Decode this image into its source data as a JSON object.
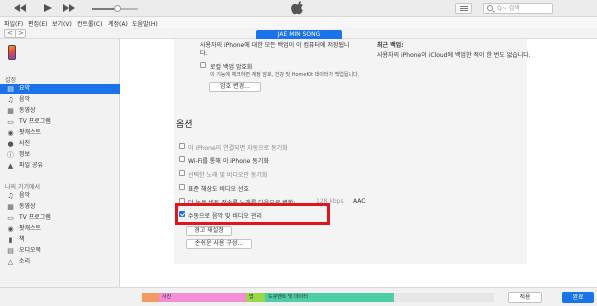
{
  "toolbar": {
    "search_placeholder": "Q~ 검색",
    "volume_level": 0.55
  },
  "menubar": {
    "items": [
      "파일(F)",
      "편집(E)",
      "보기(V)",
      "컨트롤(C)",
      "계정(A)",
      "도움말(H)"
    ]
  },
  "navbar": {
    "back": "<",
    "forward": ">",
    "device_name": "JAE MIN SONG"
  },
  "sidebar": {
    "settings_header": "설정",
    "settings_items": [
      {
        "label": "요약",
        "icon": "summary-icon",
        "selected": true
      },
      {
        "label": "음악",
        "icon": "music-icon"
      },
      {
        "label": "동영상",
        "icon": "movie-icon"
      },
      {
        "label": "TV 프로그램",
        "icon": "tv-icon"
      },
      {
        "label": "팟캐스트",
        "icon": "podcast-icon"
      },
      {
        "label": "사진",
        "icon": "photo-icon"
      },
      {
        "label": "정보",
        "icon": "info-icon"
      },
      {
        "label": "파일 공유",
        "icon": "file-share-icon"
      }
    ],
    "device_header": "나의 기기에서",
    "device_items": [
      {
        "label": "음악",
        "icon": "music-icon"
      },
      {
        "label": "동영상",
        "icon": "movie-icon"
      },
      {
        "label": "TV 프로그램",
        "icon": "tv-icon"
      },
      {
        "label": "팟캐스트",
        "icon": "podcast-icon"
      },
      {
        "label": "책",
        "icon": "book-icon"
      },
      {
        "label": "오디오북",
        "icon": "audiobook-icon"
      },
      {
        "label": "소리",
        "icon": "bell-icon"
      }
    ]
  },
  "backup": {
    "top_line1": "사용자의 iPhone에 대한 모든 백업이 이 컴퓨터에 저장됩니",
    "top_line2": "다.",
    "latest_title": "최근 백업:",
    "latest_text": "사용자의 iPhone이 iCloud에 백업한 적이 한 번도 없습니다.",
    "encrypt_label": "로컬 백업 암호화",
    "encrypt_desc": "이 기능에 체크하면 계정 암호, 건강 및 HomeKit 데이터가 백업됩니다.",
    "change_password": "암호 변경..."
  },
  "options": {
    "title": "옵션",
    "items": [
      {
        "label": "이 iPhone이 연결되면 자동으로 동기화",
        "checked": false,
        "disabled": true
      },
      {
        "label": "Wi-Fi를 통해 이 iPhone 동기화",
        "checked": false,
        "disabled": false
      },
      {
        "label": "선택한 노래 및 비디오만 동기화",
        "checked": false,
        "disabled": true
      },
      {
        "label": "표준 해상도 비디오 선호",
        "checked": false,
        "disabled": false
      },
      {
        "label": "더 높은 비트 전송률 노래를 다음으로 변환:",
        "checked": false,
        "disabled": false
      },
      {
        "label": "수동으로 음악 및 비디오 관리",
        "checked": true,
        "disabled": false
      }
    ],
    "bitrate_value": "128 kbps",
    "format_value": "AAC",
    "reset_warnings": "경고 재설정",
    "accessibility": "손쉬운 사용 구성..."
  },
  "bottombar": {
    "segments": [
      {
        "label": "",
        "color": "#f59a5f"
      },
      {
        "label": "사진",
        "color": "#f38ed4"
      },
      {
        "label": "",
        "color": "#f38ed4"
      },
      {
        "label": "앱",
        "color": "#9ad64a"
      },
      {
        "label": "",
        "color": "#9ad64a"
      },
      {
        "label": "도큐멘트 및 데이터",
        "color": "#4ccfa6"
      },
      {
        "label": "",
        "color": "#e6e6e6"
      }
    ],
    "apply": "적용",
    "done": "완료"
  },
  "colors": {
    "accent": "#1a73e8",
    "highlight": "#e3141b"
  }
}
